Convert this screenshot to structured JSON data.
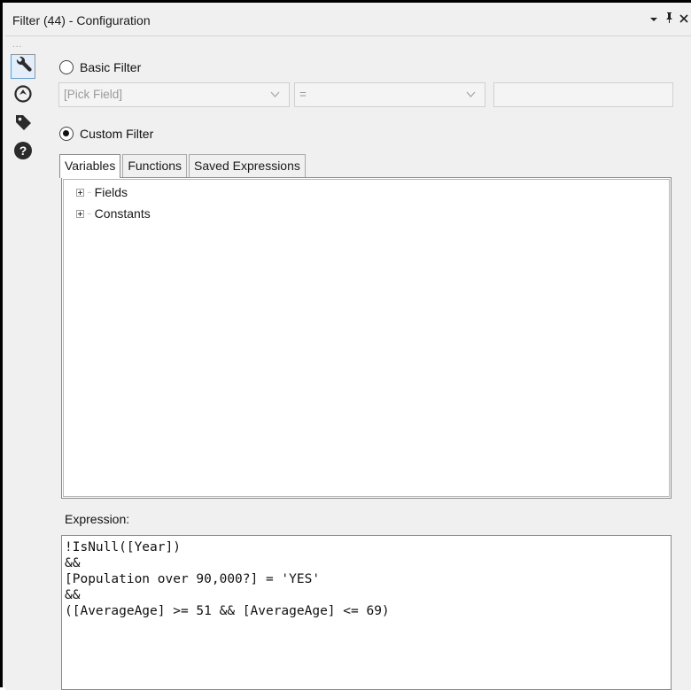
{
  "window": {
    "title": "Filter (44) - Configuration",
    "controls": [
      "▾",
      "⊥",
      "×"
    ]
  },
  "sidebar": {
    "grip": "...",
    "buttons": [
      {
        "icon": "wrench-icon",
        "active": true
      },
      {
        "icon": "target-icon",
        "active": false
      },
      {
        "icon": "tag-icon",
        "active": false
      },
      {
        "icon": "help-icon",
        "active": false
      }
    ]
  },
  "basic_filter": {
    "label": "Basic Filter",
    "checked": false,
    "field_select": "[Pick Field]",
    "operator_select": "=",
    "value_input": ""
  },
  "custom_filter": {
    "label": "Custom Filter",
    "checked": true
  },
  "tabs": [
    {
      "label": "Variables",
      "active": true
    },
    {
      "label": "Functions",
      "active": false
    },
    {
      "label": "Saved Expressions",
      "active": false
    }
  ],
  "tree": {
    "items": [
      "Fields",
      "Constants"
    ]
  },
  "expression": {
    "label": "Expression:",
    "lines": [
      "!IsNull([Year])",
      "&&",
      "[Population over 90,000?] = 'YES'",
      "&&",
      "([AverageAge] >= 51 && [AverageAge] <= 69)"
    ]
  },
  "colors": {
    "panel_bg": "#f0f0f0",
    "active_tool_border": "#6a9fd4"
  }
}
